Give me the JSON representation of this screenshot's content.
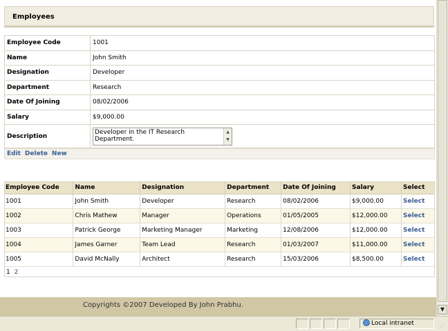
{
  "header": {
    "title": "Employees"
  },
  "details": {
    "fields": [
      {
        "label": "Employee Code",
        "value": "1001"
      },
      {
        "label": "Name",
        "value": "John Smith"
      },
      {
        "label": "Designation",
        "value": "Developer"
      },
      {
        "label": "Department",
        "value": "Research"
      },
      {
        "label": "Date Of Joining",
        "value": "08/02/2006"
      },
      {
        "label": "Salary",
        "value": "$9,000.00"
      }
    ],
    "description_label": "Description",
    "description_value": "Developer in the IT Research Department."
  },
  "actions": {
    "edit": "Edit",
    "delete": "Delete",
    "new": "New"
  },
  "grid": {
    "columns": [
      "Employee Code",
      "Name",
      "Designation",
      "Department",
      "Date Of Joining",
      "Salary",
      "Select"
    ],
    "rows": [
      [
        "1001",
        "John Smith",
        "Developer",
        "Research",
        "08/02/2006",
        "$9,000.00",
        "Select"
      ],
      [
        "1002",
        "Chris Mathew",
        "Manager",
        "Operations",
        "01/05/2005",
        "$12,000.00",
        "Select"
      ],
      [
        "1003",
        "Patrick George",
        "Marketing Manager",
        "Marketing",
        "12/08/2006",
        "$12,000.00",
        "Select"
      ],
      [
        "1004",
        "James Garner",
        "Team Lead",
        "Research",
        "01/03/2007",
        "$11,000.00",
        "Select"
      ],
      [
        "1005",
        "David McNally",
        "Architect",
        "Research",
        "15/03/2006",
        "$8,500.00",
        "Select"
      ]
    ],
    "pager": [
      "1",
      "2"
    ]
  },
  "footer": {
    "text": "Copyrights ©2007 Developed By John Prabhu."
  },
  "statusbar": {
    "zone": "Local intranet"
  },
  "colors": {
    "header_bg": "#f1ede0",
    "grid_header": "#ebe3c7",
    "footer_bg": "#d2c7a5",
    "link": "#3a5f95"
  }
}
